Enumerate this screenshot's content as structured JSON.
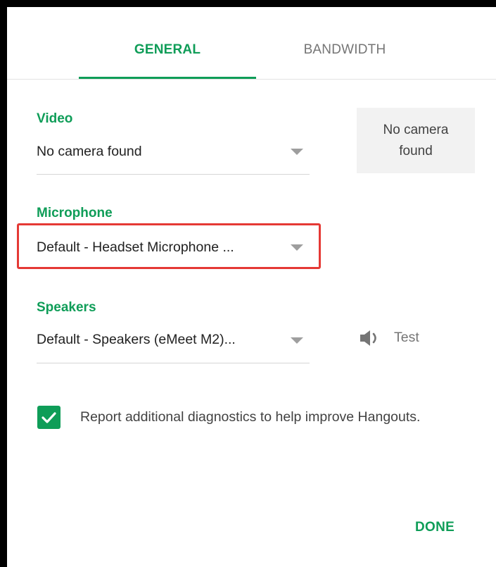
{
  "tabs": {
    "general": "GENERAL",
    "bandwidth": "BANDWIDTH"
  },
  "video": {
    "label": "Video",
    "value": "No camera found",
    "preview_text": "No camera found"
  },
  "microphone": {
    "label": "Microphone",
    "value": "Default - Headset Microphone ..."
  },
  "speakers": {
    "label": "Speakers",
    "value": "Default - Speakers (eMeet M2)...",
    "test_label": "Test"
  },
  "diagnostics": {
    "checked": true,
    "text": "Report additional diagnostics to help improve Hangouts."
  },
  "done_label": "DONE",
  "colors": {
    "accent": "#0f9d58",
    "highlight": "#e53935"
  },
  "icons": [
    "chevron-down-icon",
    "speaker-icon",
    "check-icon"
  ]
}
